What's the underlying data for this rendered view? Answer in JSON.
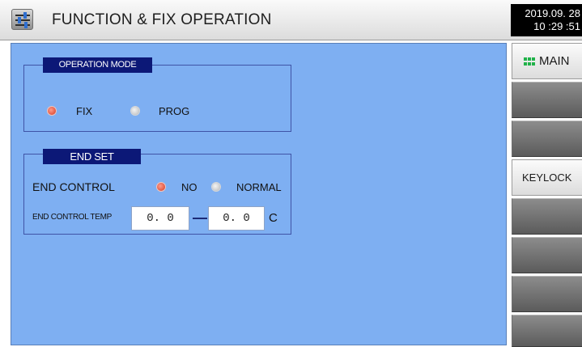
{
  "header": {
    "title": "FUNCTION & FIX OPERATION",
    "date": "2019.09. 28",
    "time": "10 :29 :51",
    "icon": "settings-sliders-icon"
  },
  "operation_mode": {
    "title": "OPERATION MODE",
    "options": [
      {
        "label": "FIX",
        "selected": true
      },
      {
        "label": "PROG",
        "selected": false
      }
    ]
  },
  "end_set": {
    "title": "END SET",
    "control_label": "END CONTROL",
    "control_options": [
      {
        "label": "NO",
        "selected": true
      },
      {
        "label": "NORMAL",
        "selected": false
      }
    ],
    "temp_label": "END CONTROL TEMP",
    "temp_low": "0. 0",
    "temp_high": "0. 0",
    "unit": "C"
  },
  "sidebar": {
    "main_label": "MAIN",
    "main_icon": "grid-dots-icon",
    "keylock_label": "KEYLOCK"
  },
  "colors": {
    "panel": "#7eaff2",
    "group_title": "#0c1877",
    "radio_on": "#d63a22",
    "accent_green": "#21b24a"
  }
}
